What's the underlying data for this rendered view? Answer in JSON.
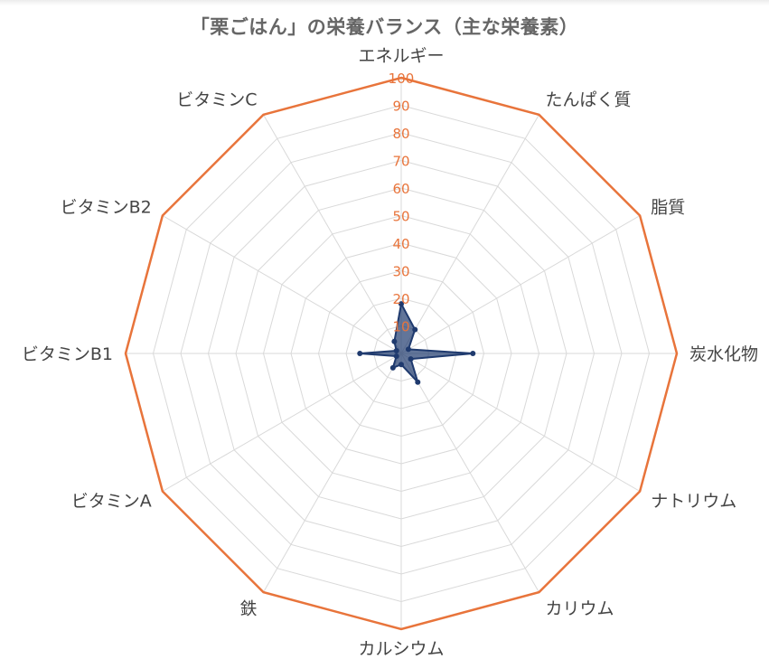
{
  "chart_data": {
    "type": "radar",
    "title": "「栗ごはん」の栄養バランス（主な栄養素）",
    "axes": [
      "エネルギー",
      "たんぱく質",
      "脂質",
      "炭水化物",
      "ナトリウム",
      "カリウム",
      "カルシウム",
      "鉄",
      "ビタミンA",
      "ビタミンB1",
      "ビタミンB2",
      "ビタミンC"
    ],
    "rlim": [
      0,
      100
    ],
    "ticks": [
      "10",
      "20",
      "30",
      "40",
      "50",
      "60",
      "70",
      "80",
      "90",
      "100"
    ],
    "grid": true,
    "series": [
      {
        "values": [
          18,
          10,
          3,
          26,
          4,
          12,
          4,
          6,
          2,
          15,
          2,
          5
        ],
        "color": "#1f3a6e",
        "fill": "rgba(31, 58, 110, 0.7)"
      }
    ],
    "outer_ring_color": "#e8743b"
  }
}
